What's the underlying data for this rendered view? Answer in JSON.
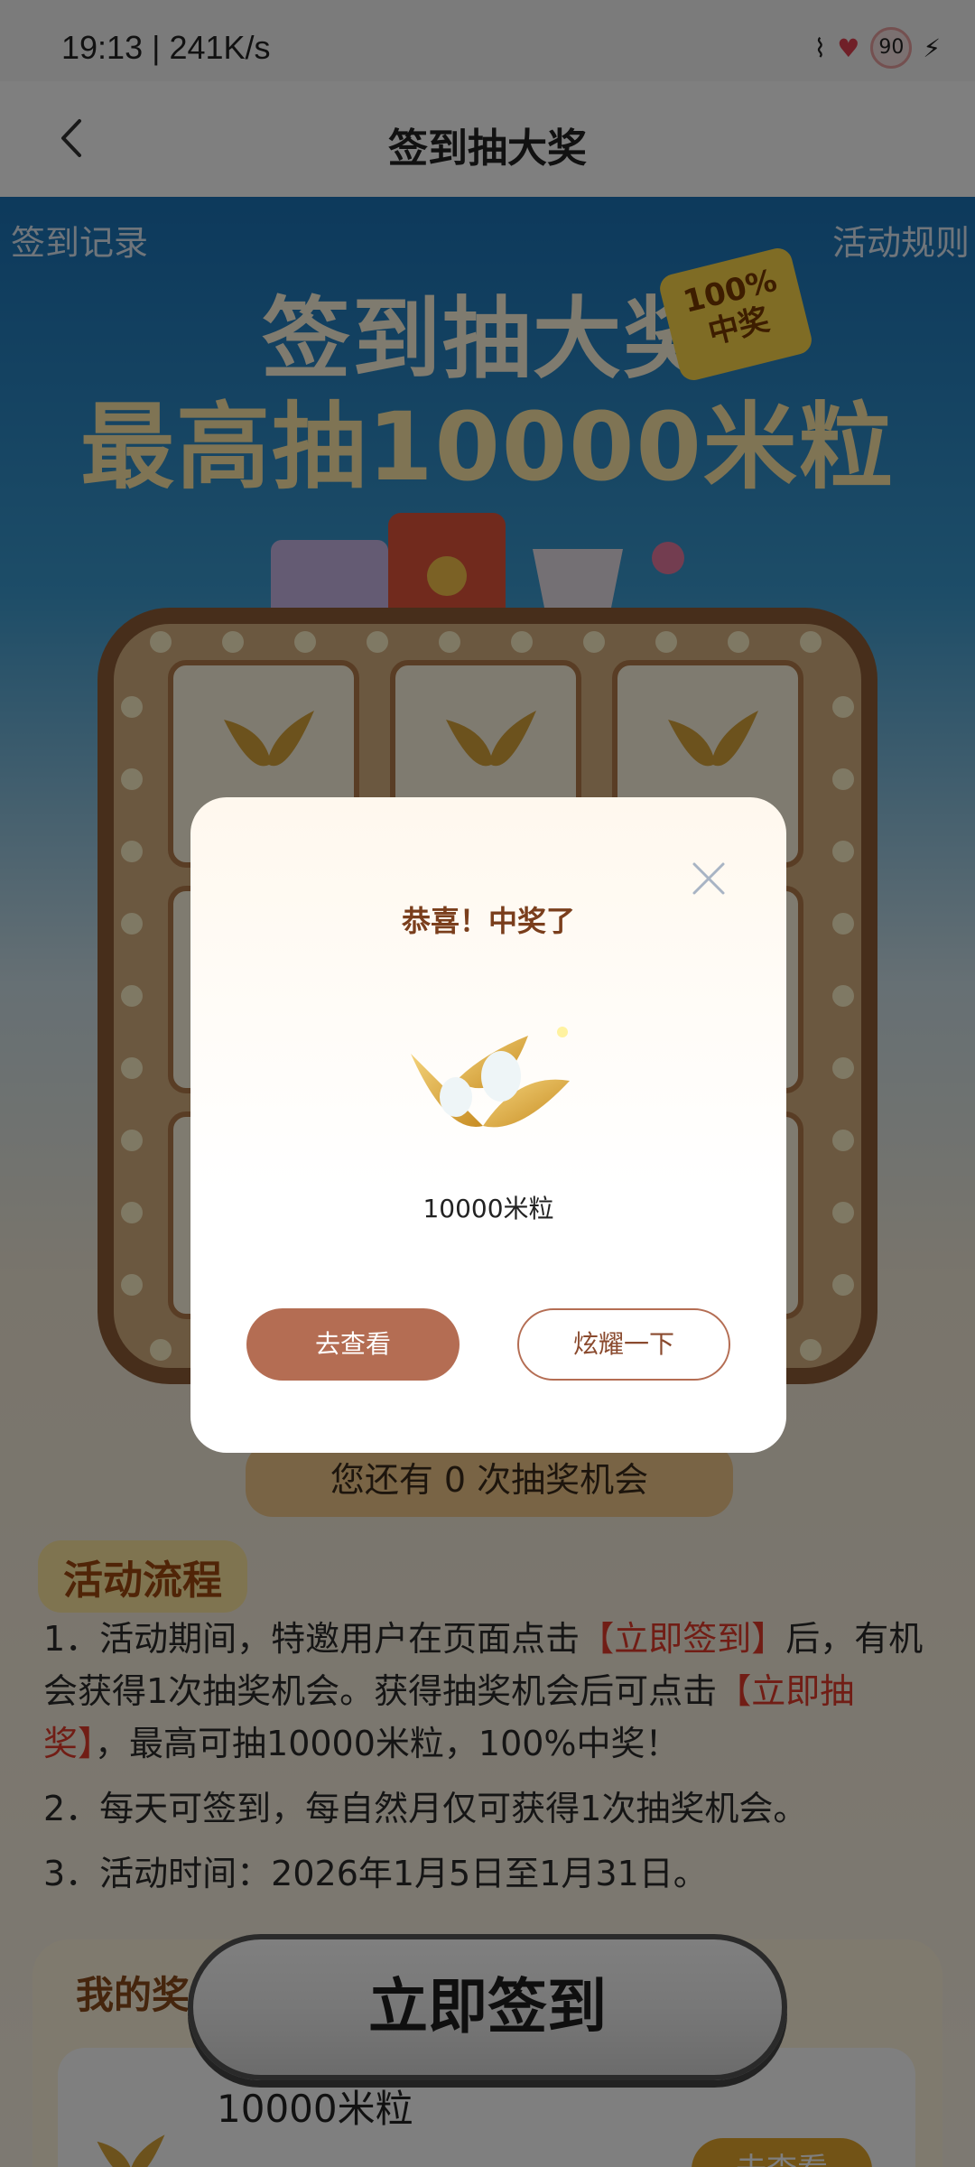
{
  "status_bar": {
    "time": "19:13 | 241K/s",
    "icons": [
      "alarm-icon",
      "nfc-icon",
      "app-icon",
      "hd-signal-icon",
      "heart-icon",
      "charging-icon"
    ],
    "battery": "90"
  },
  "header": {
    "title": "签到抽大奖",
    "back_icon": "back-chevron-icon"
  },
  "main": {
    "signin_records": "签到记录",
    "activity_rules": "活动规则",
    "hero_line1": "签到抽大奖",
    "hero_line2": "最高抽10000米粒",
    "badge_line1": "100%",
    "badge_line2": "中奖",
    "chances": "您还有 0 次抽奖机会",
    "section_title": "活动流程",
    "rules": {
      "r1_a": "1．活动期间，特邀用户在页面点击",
      "r1_b": "【立即签到】",
      "r1_c": "后，有机会获得1次抽奖机会。获得抽奖机会后可点击",
      "r1_d": "【立即抽奖】",
      "r1_e": "，最高可抽10000米粒，100%中奖！",
      "r2": "2．每天可签到，每自然月仅可获得1次抽奖机会。",
      "r3": "3．活动时间：2026年1月5日至1月31日。"
    },
    "my_prizes_title": "我的奖",
    "prize_name": "10000米粒",
    "prize_view": "去查看",
    "signin_button": "立即签到"
  },
  "modal": {
    "title": "恭喜！中奖了",
    "prize": "10000米粒",
    "view_button": "去查看",
    "share_button": "炫耀一下",
    "close_icon": "close-icon",
    "prize_icon": "leaf-coin-icon"
  },
  "colors": {
    "accent": "#b46d53",
    "highlight_red": "#e23a2a",
    "title_brown": "#7a3e1c"
  }
}
